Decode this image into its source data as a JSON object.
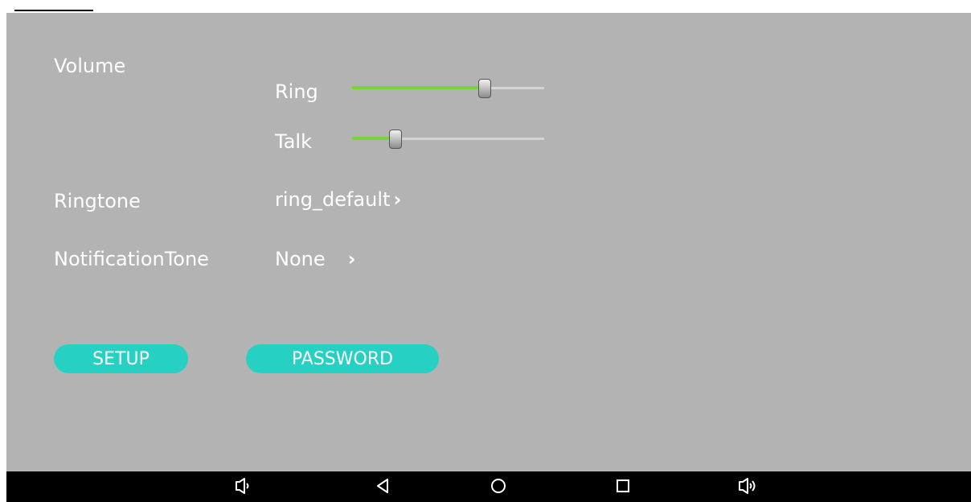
{
  "volume": {
    "label": "Volume",
    "ring": {
      "label": "Ring",
      "value": 0.69
    },
    "talk": {
      "label": "Talk",
      "value": 0.23
    }
  },
  "ringtone": {
    "label": "Ringtone",
    "value": "ring_default"
  },
  "notification_tone": {
    "label": "NotificationTone",
    "value": "None"
  },
  "buttons": {
    "setup": "SETUP",
    "password": "PASSWORD"
  },
  "icons": {
    "chevron": "chevron-right-icon",
    "nav": [
      "volume-down-icon",
      "back-icon",
      "home-icon",
      "recents-icon",
      "volume-up-icon"
    ]
  },
  "colors": {
    "background": "#b3b3b3",
    "slider_fill": "#7bd33a",
    "button": "#26d0c2",
    "navbar": "#000000"
  }
}
